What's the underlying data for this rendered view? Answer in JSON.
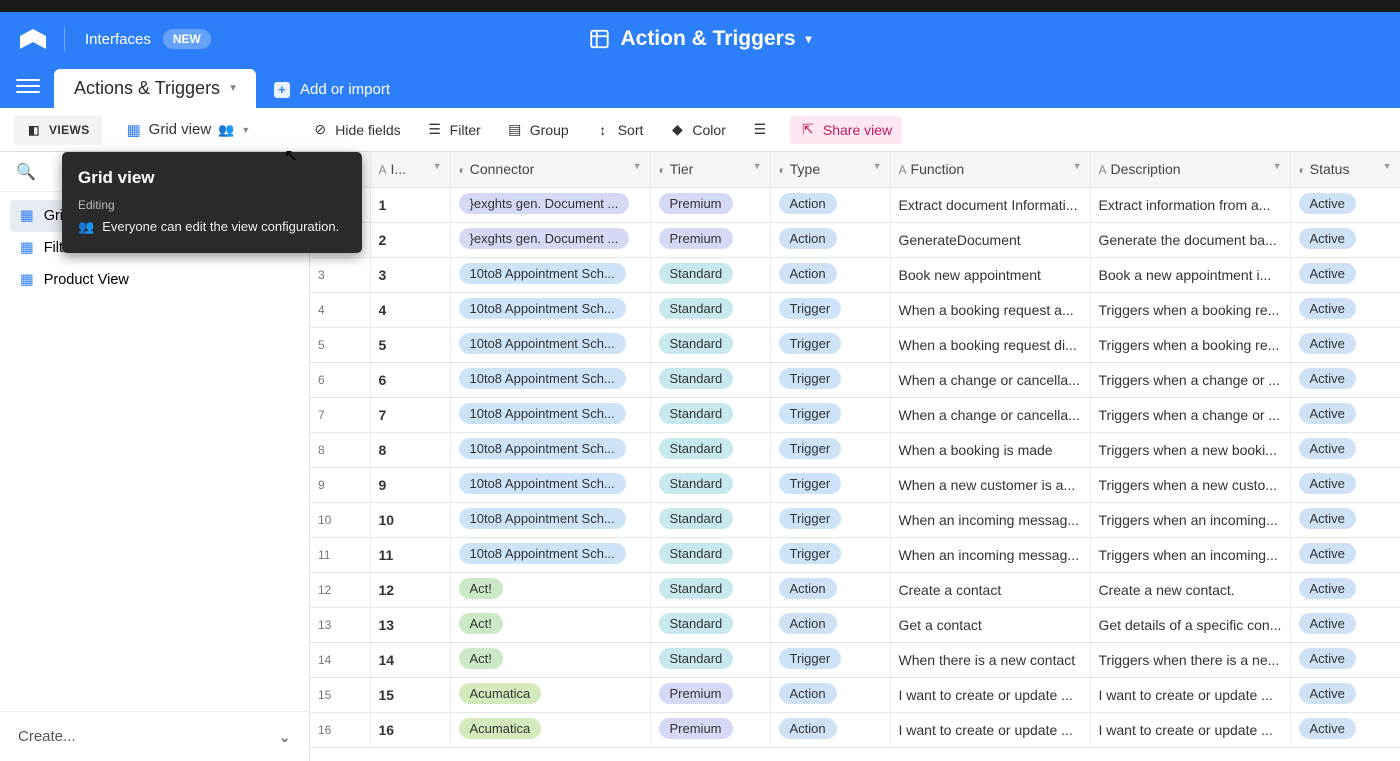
{
  "header": {
    "interfaces": "Interfaces",
    "new_badge": "NEW",
    "center_title": "Action & Triggers"
  },
  "tabs": {
    "active": "Actions & Triggers",
    "add": "Add or import"
  },
  "toolbar": {
    "views": "VIEWS",
    "grid_view": "Grid view",
    "hide_fields": "Hide fields",
    "filter": "Filter",
    "group": "Group",
    "sort": "Sort",
    "color": "Color",
    "share": "Share view"
  },
  "sidebar": {
    "items": [
      {
        "label": "Grid view"
      },
      {
        "label": "Filter View"
      },
      {
        "label": "Product View"
      }
    ],
    "create": "Create..."
  },
  "tooltip": {
    "title": "Grid view",
    "sub": "Editing",
    "body": "Everyone can edit the view configuration."
  },
  "columns": {
    "id": "I...",
    "connector": "Connector",
    "tier": "Tier",
    "type": "Type",
    "function": "Function",
    "description": "Description",
    "status": "Status"
  },
  "rows": [
    {
      "n": "1",
      "id": "1",
      "conn": "}exghts gen. Document ...",
      "conn_c": "pill-lav",
      "tier": "Premium",
      "tier_c": "pill-lav",
      "type": "Action",
      "type_c": "pill-lblue",
      "func": "Extract document Informati...",
      "desc": "Extract information from a...",
      "stat": "Active"
    },
    {
      "n": "2",
      "id": "2",
      "conn": "}exghts gen. Document ...",
      "conn_c": "pill-lav",
      "tier": "Premium",
      "tier_c": "pill-lav",
      "type": "Action",
      "type_c": "pill-lblue",
      "func": "GenerateDocument",
      "desc": "Generate the document ba...",
      "stat": "Active"
    },
    {
      "n": "3",
      "id": "3",
      "conn": "10to8 Appointment Sch...",
      "conn_c": "pill-blue",
      "tier": "Standard",
      "tier_c": "pill-teal",
      "type": "Action",
      "type_c": "pill-lblue",
      "func": "Book new appointment",
      "desc": "Book a new appointment i...",
      "stat": "Active"
    },
    {
      "n": "4",
      "id": "4",
      "conn": "10to8 Appointment Sch...",
      "conn_c": "pill-blue",
      "tier": "Standard",
      "tier_c": "pill-teal",
      "type": "Trigger",
      "type_c": "pill-blue",
      "func": "When a booking request a...",
      "desc": "Triggers when a booking re...",
      "stat": "Active"
    },
    {
      "n": "5",
      "id": "5",
      "conn": "10to8 Appointment Sch...",
      "conn_c": "pill-blue",
      "tier": "Standard",
      "tier_c": "pill-teal",
      "type": "Trigger",
      "type_c": "pill-blue",
      "func": "When a booking request di...",
      "desc": "Triggers when a booking re...",
      "stat": "Active"
    },
    {
      "n": "6",
      "id": "6",
      "conn": "10to8 Appointment Sch...",
      "conn_c": "pill-blue",
      "tier": "Standard",
      "tier_c": "pill-teal",
      "type": "Trigger",
      "type_c": "pill-blue",
      "func": "When a change or cancella...",
      "desc": "Triggers when a change or ...",
      "stat": "Active"
    },
    {
      "n": "7",
      "id": "7",
      "conn": "10to8 Appointment Sch...",
      "conn_c": "pill-blue",
      "tier": "Standard",
      "tier_c": "pill-teal",
      "type": "Trigger",
      "type_c": "pill-blue",
      "func": "When a change or cancella...",
      "desc": "Triggers when a change or ...",
      "stat": "Active"
    },
    {
      "n": "8",
      "id": "8",
      "conn": "10to8 Appointment Sch...",
      "conn_c": "pill-blue",
      "tier": "Standard",
      "tier_c": "pill-teal",
      "type": "Trigger",
      "type_c": "pill-blue",
      "func": "When a booking is made",
      "desc": "Triggers when a new booki...",
      "stat": "Active"
    },
    {
      "n": "9",
      "id": "9",
      "conn": "10to8 Appointment Sch...",
      "conn_c": "pill-blue",
      "tier": "Standard",
      "tier_c": "pill-teal",
      "type": "Trigger",
      "type_c": "pill-blue",
      "func": "When a new customer is a...",
      "desc": "Triggers when a new custo...",
      "stat": "Active"
    },
    {
      "n": "10",
      "id": "10",
      "conn": "10to8 Appointment Sch...",
      "conn_c": "pill-blue",
      "tier": "Standard",
      "tier_c": "pill-teal",
      "type": "Trigger",
      "type_c": "pill-blue",
      "func": "When an incoming messag...",
      "desc": "Triggers when an incoming...",
      "stat": "Active"
    },
    {
      "n": "11",
      "id": "11",
      "conn": "10to8 Appointment Sch...",
      "conn_c": "pill-blue",
      "tier": "Standard",
      "tier_c": "pill-teal",
      "type": "Trigger",
      "type_c": "pill-blue",
      "func": "When an incoming messag...",
      "desc": "Triggers when an incoming...",
      "stat": "Active"
    },
    {
      "n": "12",
      "id": "12",
      "conn": "Act!",
      "conn_c": "pill-green",
      "tier": "Standard",
      "tier_c": "pill-teal",
      "type": "Action",
      "type_c": "pill-lblue",
      "func": "Create a contact",
      "desc": "Create a new contact.",
      "stat": "Active"
    },
    {
      "n": "13",
      "id": "13",
      "conn": "Act!",
      "conn_c": "pill-green",
      "tier": "Standard",
      "tier_c": "pill-teal",
      "type": "Action",
      "type_c": "pill-lblue",
      "func": "Get a contact",
      "desc": "Get details of a specific con...",
      "stat": "Active"
    },
    {
      "n": "14",
      "id": "14",
      "conn": "Act!",
      "conn_c": "pill-green",
      "tier": "Standard",
      "tier_c": "pill-teal",
      "type": "Trigger",
      "type_c": "pill-blue",
      "func": "When there is a new contact",
      "desc": "Triggers when there is a ne...",
      "stat": "Active"
    },
    {
      "n": "15",
      "id": "15",
      "conn": "Acumatica",
      "conn_c": "pill-lime",
      "tier": "Premium",
      "tier_c": "pill-lav",
      "type": "Action",
      "type_c": "pill-lblue",
      "func": "I want to create or update ...",
      "desc": "I want to create or update ...",
      "stat": "Active"
    },
    {
      "n": "16",
      "id": "16",
      "conn": "Acumatica",
      "conn_c": "pill-lime",
      "tier": "Premium",
      "tier_c": "pill-lav",
      "type": "Action",
      "type_c": "pill-lblue",
      "func": "I want to create or update ...",
      "desc": "I want to create or update ...",
      "stat": "Active"
    }
  ]
}
